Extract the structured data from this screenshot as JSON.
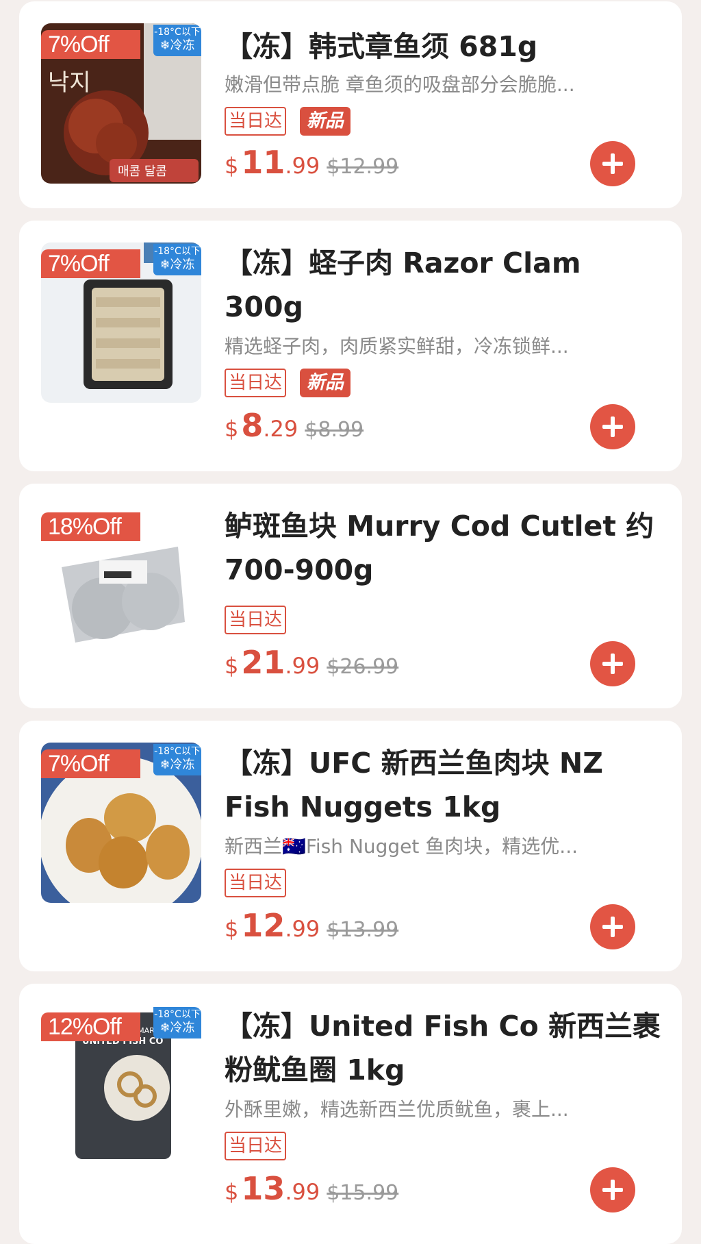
{
  "colors": {
    "accent": "#e25544",
    "frozen_badge": "#2f86d9",
    "background": "#f4efed"
  },
  "icons": {
    "add": "plus-icon",
    "snowflake": "snowflake-icon"
  },
  "products": [
    {
      "discount": "7%Off",
      "frozen_temp": "-18°C以下",
      "frozen_label": "❄冷冻",
      "title": "【冻】韩式章鱼须 681g",
      "description": "嫩滑但带点脆 章鱼须的吸盘部分会脆脆...",
      "tag_same_day": "当日达",
      "tag_new": "新品",
      "currency": "$",
      "price_int": "11",
      "price_dec": ".99",
      "old_price": "$12.99",
      "image_text_1": "낙지",
      "image_text_2": "매콤 달콤"
    },
    {
      "discount": "7%Off",
      "frozen_temp": "-18°C以下",
      "frozen_label": "❄冷冻",
      "title": "【冻】蛏子肉 Razor Clam 300g",
      "description": "精选蛏子肉，肉质紧实鲜甜，冷冻锁鲜...",
      "tag_same_day": "当日达",
      "tag_new": "新品",
      "currency": "$",
      "price_int": "8",
      "price_dec": ".29",
      "old_price": "$8.99"
    },
    {
      "discount": "18%Off",
      "title": "鲈斑鱼块 Murry Cod Cutlet 约 700-900g",
      "tag_same_day": "当日达",
      "currency": "$",
      "price_int": "21",
      "price_dec": ".99",
      "old_price": "$26.99"
    },
    {
      "discount": "7%Off",
      "frozen_temp": "-18°C以下",
      "frozen_label": "❄冷冻",
      "title": "【冻】UFC 新西兰鱼肉块 NZ Fish Nuggets 1kg",
      "description": "新西兰🇦🇺Fish Nugget 鱼肉块，精选优...",
      "tag_same_day": "当日达",
      "currency": "$",
      "price_int": "12",
      "price_dec": ".99",
      "old_price": "$13.99"
    },
    {
      "discount": "12%Off",
      "frozen_temp": "-18°C以下",
      "frozen_label": "❄冷冻",
      "title": "【冻】United Fish Co 新西兰裹粉鱿鱼圈 1kg",
      "description": "外酥里嫩，精选新西兰优质鱿鱼，裹上...",
      "tag_same_day": "当日达",
      "currency": "$",
      "price_int": "13",
      "price_dec": ".99",
      "old_price": "$15.99",
      "image_text_1": "UNITED FISH CO",
      "image_text_2": "CALAMARI RINGS"
    }
  ]
}
